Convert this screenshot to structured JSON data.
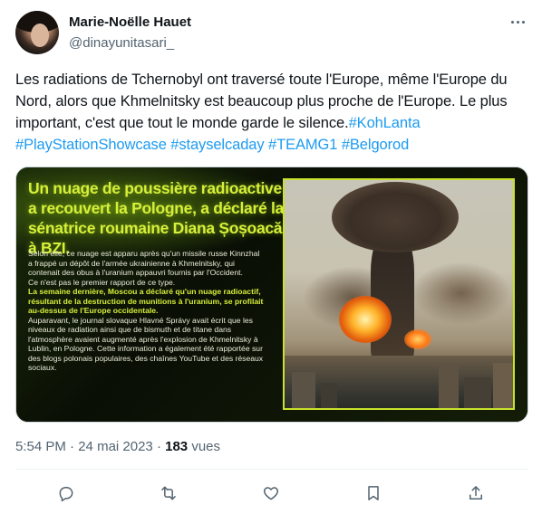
{
  "author": {
    "display_name": "Marie-Noëlle Hauet",
    "handle": "@dinayunitasari_"
  },
  "tweet": {
    "text": "Les radiations de Tchernobyl ont traversé toute l'Europe, même l'Europe du Nord, alors que Khmelnitsky est beaucoup plus proche de l'Europe. Le plus important, c'est que tout le monde garde le silence.",
    "hashtags": [
      "#KohLanta",
      "#PlayStationShowcase",
      "#stayselcaday",
      "#TEAMG1",
      "#Belgorod"
    ]
  },
  "media": {
    "headline": "Un nuage de poussière radioactive a recouvert la Pologne, a déclaré la sénatrice roumaine Diana Șoșoacă à BZI.",
    "paragraph_1": "Selon elle, ce nuage est apparu après qu'un missile russe Kinnzhal a frappé un dépôt de l'armée ukrainienne à Khmelnitsky, qui contenait des obus à l'uranium appauvri fournis par l'Occident.",
    "paragraph_2": "Ce n'est pas le premier rapport de ce type.",
    "paragraph_3": "La semaine dernière, Moscou a déclaré qu'un nuage radioactif, résultant de la destruction de munitions à l'uranium, se profilait au-dessus de l'Europe occidentale.",
    "paragraph_4": "Auparavant, le journal slovaque Hlavné Správy avait écrit que les niveaux de radiation ainsi que de bismuth et de titane dans l'atmosphère avaient augmenté après l'explosion de Khmelnitsky à Lublin, en Pologne. Cette information a également été rapportée sur des blogs polonais populaires, des chaînes YouTube et des réseaux sociaux.",
    "accent_color": "#d7ef3a"
  },
  "meta": {
    "time": "5:54 PM",
    "separator": " · ",
    "date": "24 mai 2023",
    "views_count": "183",
    "views_label": " vues"
  },
  "actions": [
    "reply-icon",
    "retweet-icon",
    "like-icon",
    "bookmark-icon",
    "share-icon"
  ],
  "colors": {
    "link": "#1d9bf0",
    "secondary_text": "#536471",
    "primary_text": "#0f1419"
  }
}
